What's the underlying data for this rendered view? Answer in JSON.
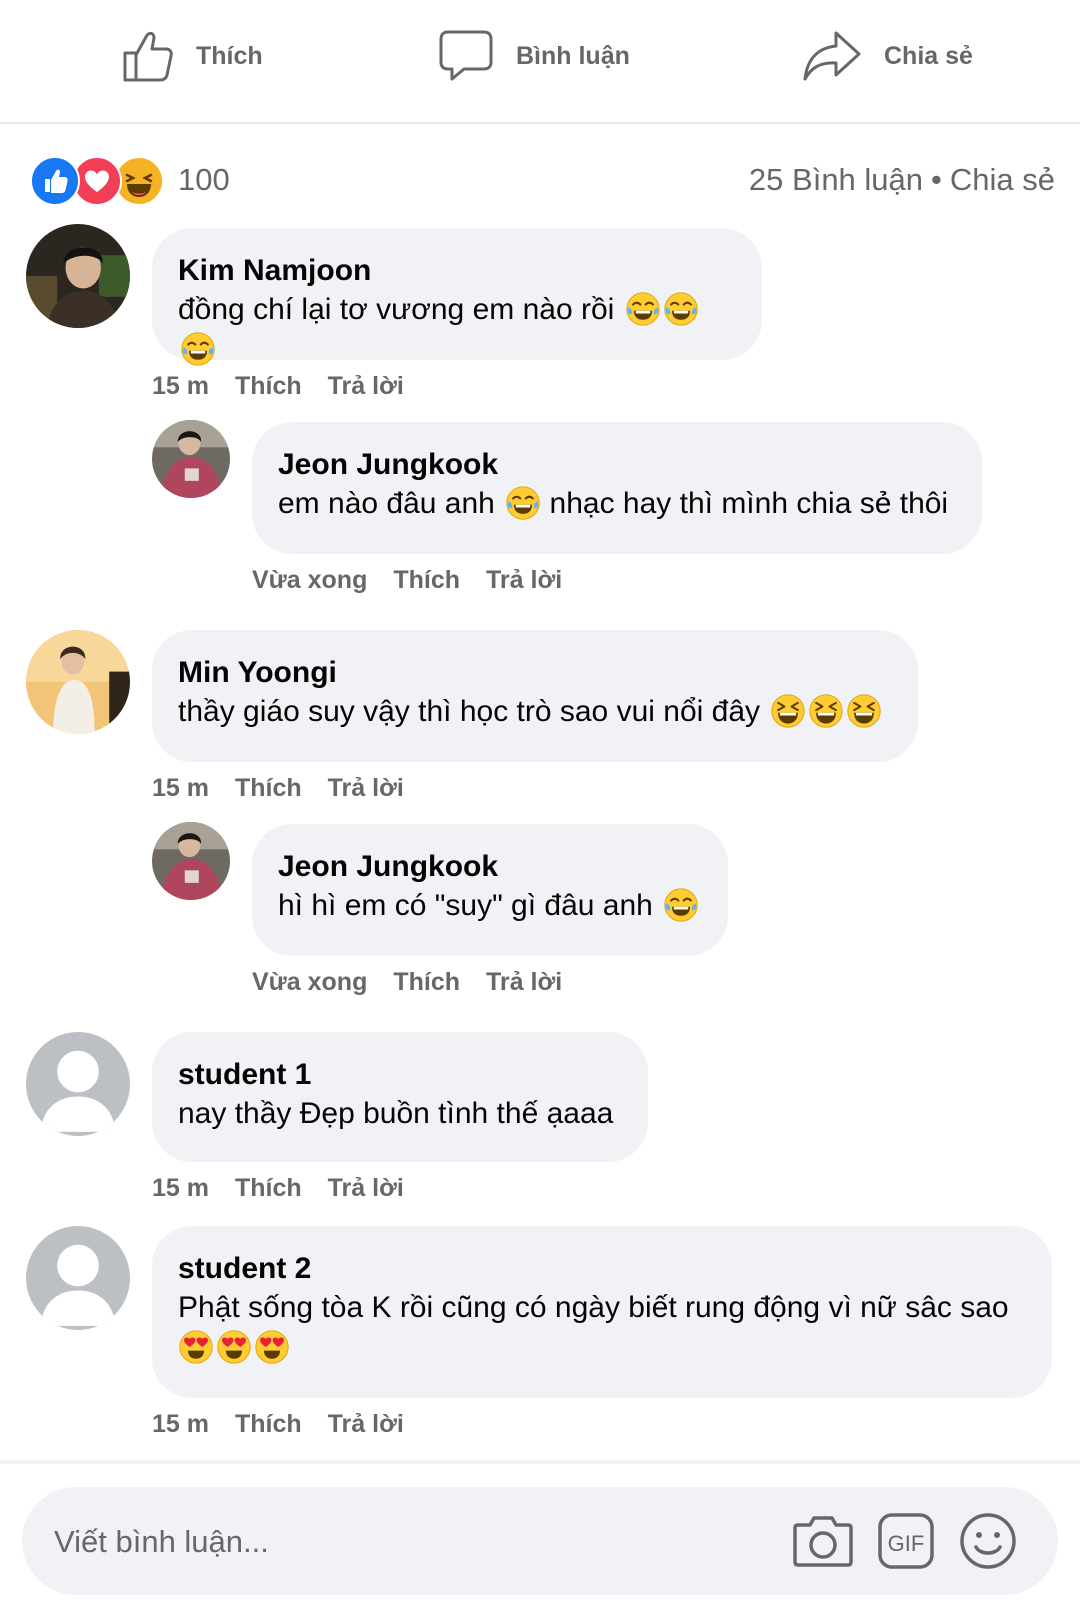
{
  "action_bar": {
    "like_label": "Thích",
    "comment_label": "Bình luận",
    "share_label": "Chia sẻ"
  },
  "summary": {
    "reaction_icons": [
      "like-reaction-icon",
      "love-reaction-icon",
      "haha-reaction-icon"
    ],
    "reaction_count": "100",
    "comment_count": "25",
    "comments_label": "Bình luận",
    "separator": "•",
    "share_label": "Chia sẻ"
  },
  "comments": [
    {
      "name": "Kim Namjoon",
      "text": "đồng chí lại tơ vương em nào rồi",
      "emojis": [
        "tears-of-joy",
        "tears-of-joy",
        "tears-of-joy"
      ],
      "time": "15 m",
      "like_label": "Thích",
      "reply_label": "Trả lời",
      "avatar": "photo",
      "replies": [
        {
          "name": "Jeon Jungkook",
          "text_before": "em nào đâu anh",
          "emoji": "tears-of-joy",
          "text_after": "nhạc hay thì mình chia sẻ thôi",
          "time": "Vừa xong",
          "like_label": "Thích",
          "reply_label": "Trả lời",
          "avatar": "photo"
        }
      ]
    },
    {
      "name": "Min Yoongi",
      "text": "thầy giáo suy vậy thì học trò sao vui nổi đây",
      "emojis": [
        "grinning-squinting",
        "grinning-squinting",
        "grinning-squinting"
      ],
      "time": "15 m",
      "like_label": "Thích",
      "reply_label": "Trả lời",
      "avatar": "photo",
      "replies": [
        {
          "name": "Jeon Jungkook",
          "text_before": "hì hì em có \"suy\" gì đâu anh",
          "emoji": "tears-of-joy",
          "text_after": "",
          "time": "Vừa xong",
          "like_label": "Thích",
          "reply_label": "Trả lời",
          "avatar": "photo"
        }
      ]
    },
    {
      "name": "student 1",
      "text": "nay thầy Đẹp buồn tình thế ạaaa",
      "emojis": [],
      "time": "15 m",
      "like_label": "Thích",
      "reply_label": "Trả lời",
      "avatar": "default"
    },
    {
      "name": "student 2",
      "text": "Phật sống tòa K rồi cũng có ngày biết rung động vì nữ sâc sao",
      "emojis": [
        "heart-eyes",
        "heart-eyes",
        "heart-eyes"
      ],
      "time": "15 m",
      "like_label": "Thích",
      "reply_label": "Trả lời",
      "avatar": "default"
    }
  ],
  "composer": {
    "placeholder": "Viết bình luận...",
    "icons": [
      "camera-icon",
      "gif-icon",
      "smiley-icon"
    ],
    "gif_label": "GIF"
  },
  "colors": {
    "bubble": "#f0f2f5",
    "secondary_text": "#65676b",
    "like_blue": "#1877f2",
    "love_red": "#f33e58",
    "haha_yellow": "#f7b125"
  }
}
